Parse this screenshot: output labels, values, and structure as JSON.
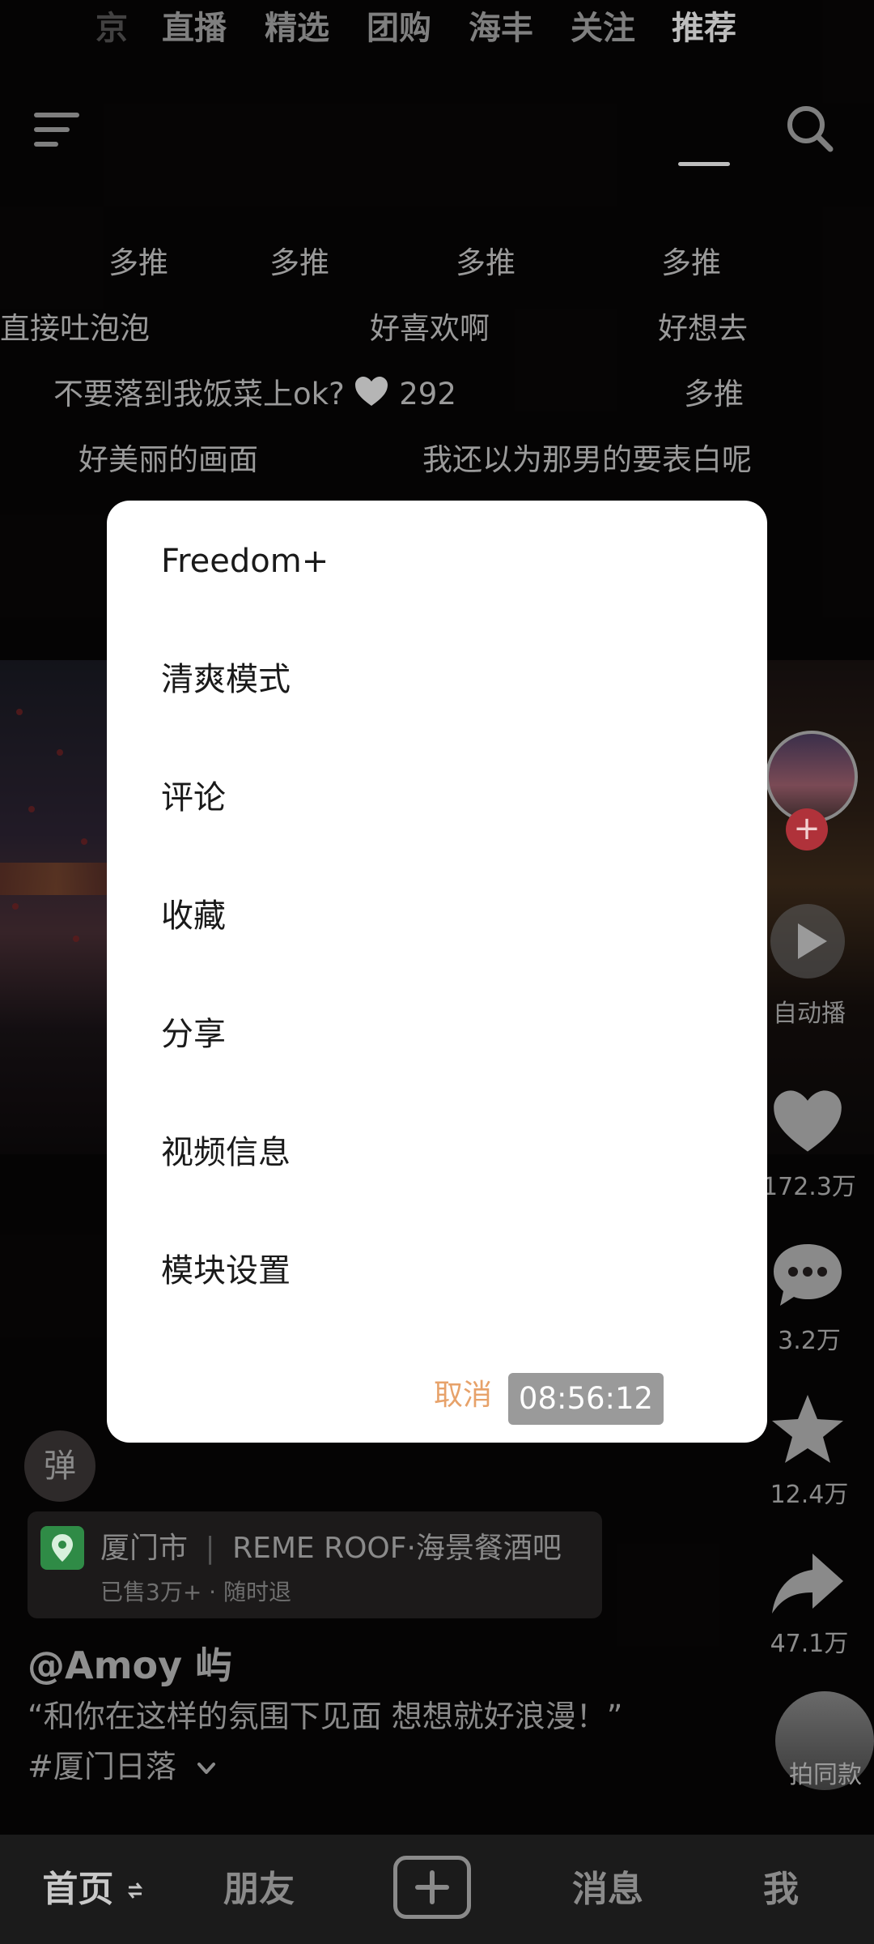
{
  "top_tabs": {
    "items": [
      {
        "label": "直播"
      },
      {
        "label": "精选"
      },
      {
        "label": "团购"
      },
      {
        "label": "海丰"
      },
      {
        "label": "关注"
      },
      {
        "label": "推荐"
      }
    ],
    "active": "推荐",
    "partial_left": "京"
  },
  "danmaku": {
    "row1": [
      "多推",
      "多推",
      "多推",
      "多推"
    ],
    "row2": [
      "直接吐泡泡",
      "好喜欢啊",
      "好想去"
    ],
    "row3_text": "不要落到我饭菜上ok?",
    "row3_likes": "292",
    "row3_right": "多推",
    "row4": [
      "好美丽的画面",
      "我还以为那男的要表白呢"
    ]
  },
  "modal": {
    "items": [
      {
        "label": "Freedom+"
      },
      {
        "label": "清爽模式"
      },
      {
        "label": "评论"
      },
      {
        "label": "收藏"
      },
      {
        "label": "分享"
      },
      {
        "label": "视频信息"
      },
      {
        "label": "模块设置"
      }
    ],
    "cancel_label": "取消",
    "time": "08:56:12"
  },
  "side_actions": {
    "autoplay_label": "自动播",
    "likes": "172.3万",
    "comments": "3.2万",
    "favorites": "12.4万",
    "shares": "47.1万"
  },
  "bottom_info": {
    "danmu_toggle": "弹",
    "poi_city": "厦门市",
    "poi_name": "REME ROOF·海景餐酒吧",
    "poi_sub": "已售3万+ · 随时退",
    "author": "@Amoy 屿",
    "caption": "“和你在这样的氛围下见面 想想就好浪漫！”",
    "hashtag": "#厦门日落",
    "same_style_label": "拍同款"
  },
  "bottom_nav": {
    "home": "首页",
    "friends": "朋友",
    "messages": "消息",
    "me": "我"
  },
  "colors": {
    "accent_cancel": "#e7a26a",
    "like_red": "#b0323a",
    "poi_green": "#2f8b46"
  }
}
